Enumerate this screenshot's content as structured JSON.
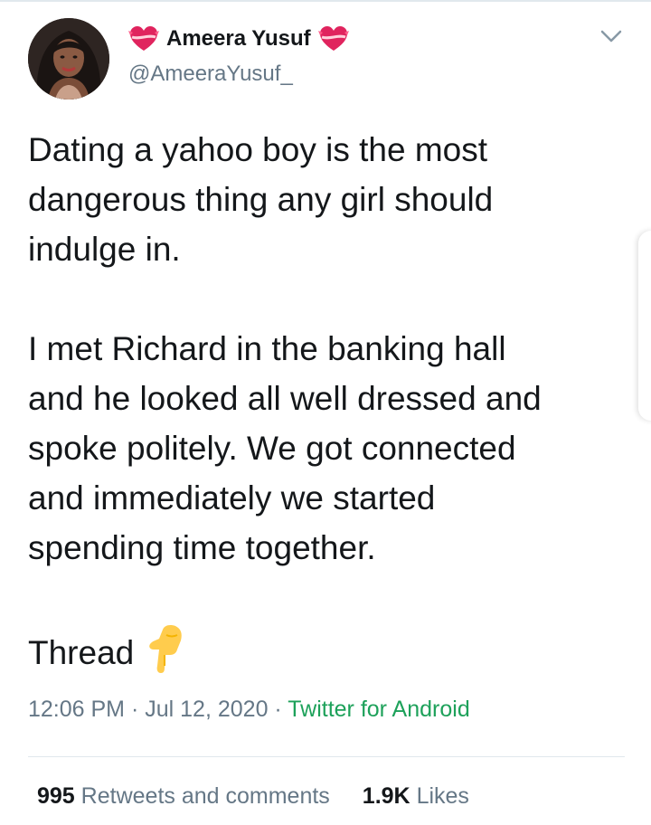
{
  "author": {
    "display_name": "Ameera Yusuf",
    "handle": "@AmeeraYusuf_",
    "name_emoji": "heart-with-ribbon"
  },
  "tweet": {
    "paragraphs": [
      "Dating a yahoo boy is the most\ndangerous thing any girl should\nindulge in.",
      "I met Richard in the banking hall\nand he looked all well dressed and\nspoke politely. We got connected\nand immediately we started\nspending time together."
    ],
    "thread_label": "Thread",
    "thread_emoji": "backhand-index-pointing-down"
  },
  "meta": {
    "time": "12:06 PM",
    "separator": "·",
    "date": "Jul 12, 2020",
    "source": "Twitter for Android"
  },
  "stats": {
    "retweets_count": "995",
    "retweets_label": "Retweets and comments",
    "likes_count": "1.9K",
    "likes_label": "Likes"
  },
  "colors": {
    "text": "#14171a",
    "secondary": "#657786",
    "source_link": "#1da15a",
    "divider": "#e1e8ed"
  }
}
